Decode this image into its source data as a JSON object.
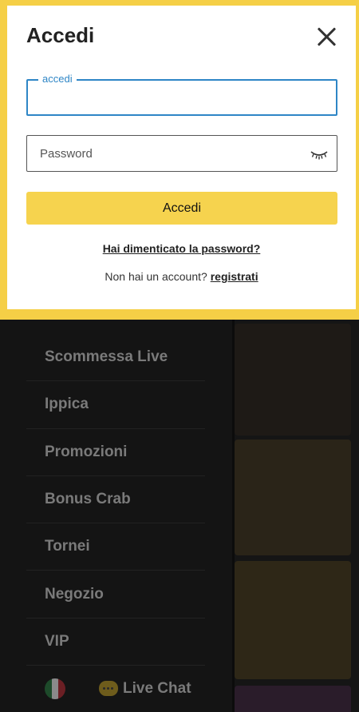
{
  "modal": {
    "title": "Accedi",
    "username_label": "accedi",
    "username_value": "",
    "password_placeholder": "Password",
    "submit_label": "Accedi",
    "forgot_password": "Hai dimenticato la password?",
    "no_account_text": "Non hai un account?",
    "register_link": "registrati"
  },
  "sidebar": {
    "items": [
      {
        "label": "Scommessa Live"
      },
      {
        "label": "Ippica"
      },
      {
        "label": "Promozioni"
      },
      {
        "label": "Bonus Crab"
      },
      {
        "label": "Tornei"
      },
      {
        "label": "Negozio"
      },
      {
        "label": "VIP"
      }
    ],
    "live_chat": "Live Chat"
  },
  "colors": {
    "accent": "#f6d34e",
    "focus_blue": "#2e86c6",
    "background": "#141414"
  }
}
